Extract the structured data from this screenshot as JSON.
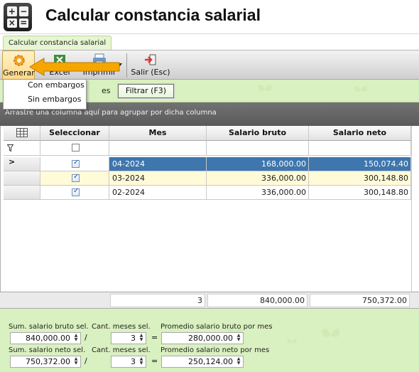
{
  "app": {
    "title": "Calcular constancia salarial",
    "icon_glyphs": [
      "+",
      "−",
      "×",
      "="
    ]
  },
  "tabs": [
    {
      "label": "Calcular constancia salarial",
      "active": true
    }
  ],
  "toolbar": {
    "generar_label": "Generar",
    "excel_label": "Excel",
    "imprimir_label": "Imprimir",
    "salir_label": "Salir (Esc)"
  },
  "generar_menu": {
    "items": [
      "Con embargos",
      "Sin embargos"
    ]
  },
  "filter_bar": {
    "partial_text": "es",
    "filtrar_label": "Filtrar (F3)"
  },
  "grid": {
    "group_hint": "Arrastre una columna aquí para agrupar por dicha columna",
    "columns": [
      "Seleccionar",
      "Mes",
      "Salario bruto",
      "Salario neto"
    ],
    "rows": [
      {
        "selected": true,
        "mes": "04-2024",
        "bruto": "168,000.00",
        "neto": "150,074.40",
        "current": true
      },
      {
        "selected": true,
        "mes": "03-2024",
        "bruto": "336,000.00",
        "neto": "300,148.80",
        "current": false
      },
      {
        "selected": true,
        "mes": "02-2024",
        "bruto": "336,000.00",
        "neto": "300,148.80",
        "current": false
      }
    ],
    "footer": {
      "count": "3",
      "bruto_total": "840,000.00",
      "neto_total": "750,372.00"
    }
  },
  "summary": {
    "sum_bruto_label": "Sum. salario bruto sel.",
    "sum_bruto_value": "840,000.00",
    "cant_meses_label_1": "Cant. meses sel.",
    "cant_meses_value_1": "3",
    "prom_bruto_label": "Promedio salario bruto por mes",
    "prom_bruto_value": "280,000.00",
    "sum_neto_label": "Sum. salario neto sel.",
    "sum_neto_value": "750,372.00",
    "cant_meses_label_2": "Cant. meses sel.",
    "cant_meses_value_2": "3",
    "prom_neto_label": "Promedio salario neto por mes",
    "prom_neto_value": "250,124.00",
    "op_div": "/",
    "op_eq": "="
  },
  "colors": {
    "accent_green": "#d9f0c0",
    "selection_blue": "#3e76ad",
    "row_alt": "#fffbd8",
    "annotation_orange": "#f7a600"
  }
}
